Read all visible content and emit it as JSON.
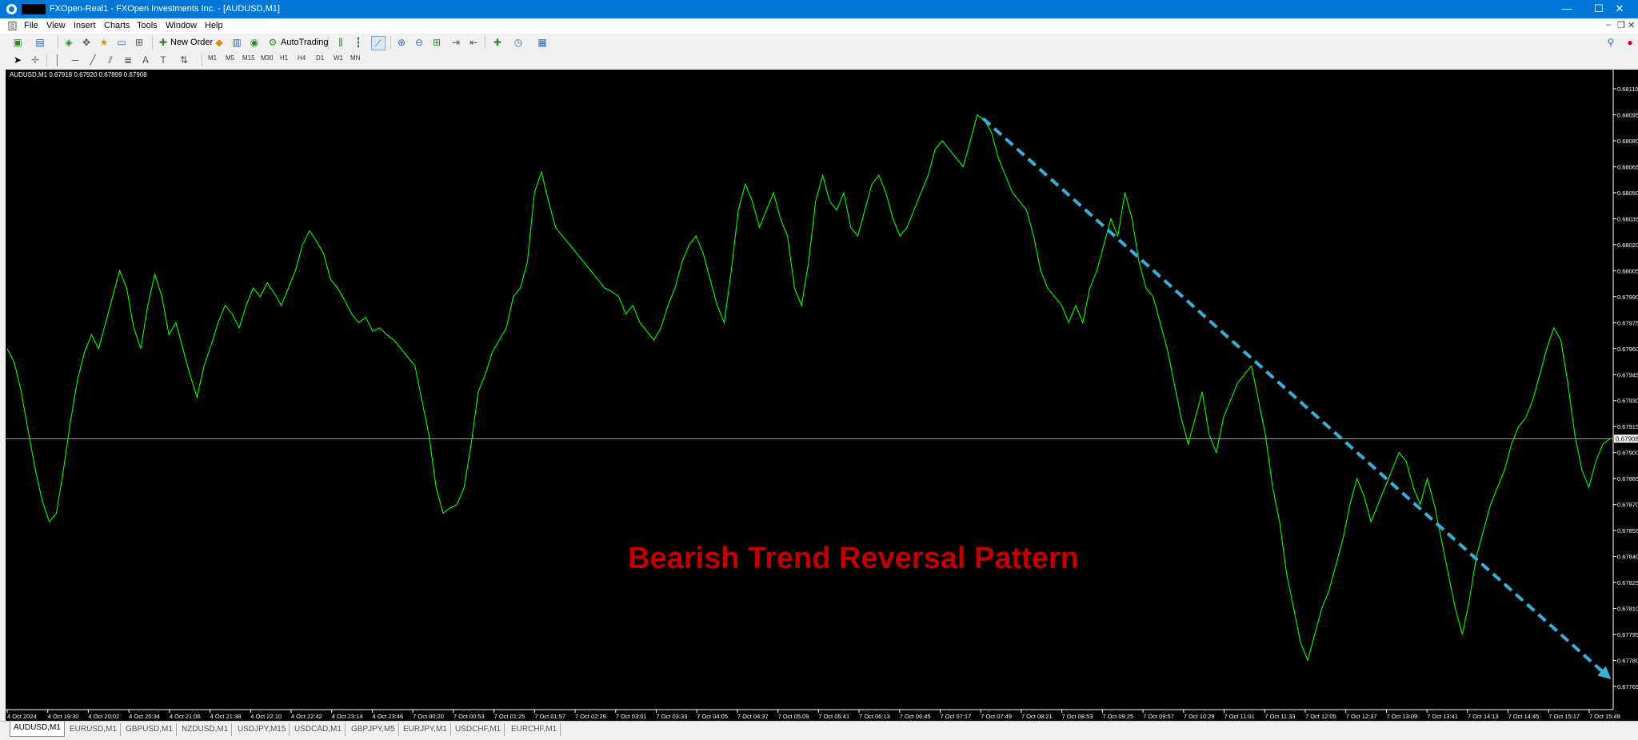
{
  "window": {
    "title": "FXOpen-Real1 - FXOpen Investments Inc. - [AUDUSD,M1]",
    "controls": [
      "—",
      "☐",
      "✕"
    ]
  },
  "menu": {
    "items": [
      "File",
      "View",
      "Insert",
      "Charts",
      "Tools",
      "Window",
      "Help"
    ]
  },
  "toolbar": {
    "new_order_label": "New Order",
    "autotrading_label": "AutoTrading"
  },
  "timeframes": [
    "M1",
    "M5",
    "M15",
    "M30",
    "H1",
    "H4",
    "D1",
    "W1",
    "MN"
  ],
  "chart": {
    "info": "AUDUSD,M1  0.67918 0.67920 0.67899 0.67908",
    "annotation": "Bearish Trend Reversal Pattern",
    "current_price_label": "0.67908",
    "colors": {
      "background": "#000000",
      "line": "#00ff00",
      "trend_arrow": "#3aaed8",
      "annotation": "#c00000"
    }
  },
  "chart_data": {
    "type": "line",
    "series": [
      {
        "y": [
          0.6796,
          0.67952,
          0.67935,
          0.67912,
          0.6789,
          0.67872,
          0.6786,
          0.67865,
          0.6789,
          0.67918,
          0.67942,
          0.67958,
          0.67968,
          0.6796,
          0.67975,
          0.6799,
          0.68005,
          0.67995,
          0.67972,
          0.6796,
          0.67985,
          0.68003,
          0.6799,
          0.67968,
          0.67975,
          0.6796,
          0.67945,
          0.67932,
          0.6795,
          0.67962,
          0.67975,
          0.67985,
          0.6798,
          0.67972,
          0.67985,
          0.67995,
          0.6799,
          0.67998,
          0.67992,
          0.67985,
          0.67995,
          0.68005,
          0.6802,
          0.68028,
          0.68022,
          0.68015,
          0.68,
          0.67995,
          0.67988,
          0.6798,
          0.67975,
          0.67978,
          0.6797,
          0.67972,
          0.67968,
          0.67965,
          0.6796,
          0.67955,
          0.6795,
          0.6793,
          0.6791,
          0.6788,
          0.67865,
          0.67868,
          0.6787,
          0.6788,
          0.67905,
          0.67935,
          0.67945,
          0.67958,
          0.67965,
          0.67972,
          0.6799,
          0.67995,
          0.6801,
          0.6805,
          0.68062,
          0.68045,
          0.6803,
          0.68025,
          0.6802,
          0.68015,
          0.6801,
          0.68005,
          0.68,
          0.67995,
          0.67993,
          0.6799,
          0.6798,
          0.67985,
          0.67975,
          0.6797,
          0.67965,
          0.67972,
          0.67985,
          0.67995,
          0.6801,
          0.6802,
          0.68025,
          0.68015,
          0.68,
          0.67985,
          0.67975,
          0.68005,
          0.6804,
          0.68055,
          0.68045,
          0.6803,
          0.6804,
          0.6805,
          0.68035,
          0.68025,
          0.67995,
          0.67985,
          0.6801,
          0.68045,
          0.6806,
          0.68045,
          0.6804,
          0.6805,
          0.6803,
          0.68025,
          0.6804,
          0.68055,
          0.6806,
          0.6805,
          0.68035,
          0.68025,
          0.6803,
          0.6804,
          0.6805,
          0.6806,
          0.68075,
          0.6808,
          0.68075,
          0.6807,
          0.68065,
          0.6808,
          0.68095,
          0.68092,
          0.68085,
          0.6807,
          0.6806,
          0.6805,
          0.68045,
          0.6804,
          0.68025,
          0.68005,
          0.67995,
          0.6799,
          0.67985,
          0.67975,
          0.67985,
          0.67975,
          0.67995,
          0.68005,
          0.6802,
          0.68035,
          0.68025,
          0.6805,
          0.68035,
          0.6801,
          0.67995,
          0.6799,
          0.67975,
          0.6796,
          0.6794,
          0.6792,
          0.67905,
          0.6792,
          0.67935,
          0.6791,
          0.679,
          0.6792,
          0.6793,
          0.6794,
          0.67945,
          0.6795,
          0.6793,
          0.6791,
          0.6788,
          0.6786,
          0.6783,
          0.6781,
          0.6779,
          0.6778,
          0.67795,
          0.6781,
          0.6782,
          0.67835,
          0.6785,
          0.6787,
          0.67885,
          0.67875,
          0.6786,
          0.6787,
          0.6788,
          0.6789,
          0.679,
          0.67895,
          0.6788,
          0.6787,
          0.67885,
          0.6787,
          0.6785,
          0.6783,
          0.6781,
          0.67795,
          0.67815,
          0.6784,
          0.67855,
          0.6787,
          0.6788,
          0.6789,
          0.67905,
          0.67915,
          0.6792,
          0.6793,
          0.67945,
          0.6796,
          0.67972,
          0.67965,
          0.6794,
          0.6791,
          0.6789,
          0.6788,
          0.67895,
          0.67905,
          0.67908
        ]
      }
    ],
    "x_ticks": [
      "4 Oct 2024",
      "4 Oct 19:30",
      "4 Oct 20:02",
      "4 Oct 20:34",
      "4 Oct 21:06",
      "4 Oct 21:38",
      "4 Oct 22:10",
      "4 Oct 22:42",
      "4 Oct 23:14",
      "4 Oct 23:46",
      "7 Oct 00:20",
      "7 Oct 00:53",
      "7 Oct 01:25",
      "7 Oct 01:57",
      "7 Oct 02:29",
      "7 Oct 03:01",
      "7 Oct 03:33",
      "7 Oct 04:05",
      "7 Oct 04:37",
      "7 Oct 05:09",
      "7 Oct 05:41",
      "7 Oct 06:13",
      "7 Oct 06:45",
      "7 Oct 07:17",
      "7 Oct 07:49",
      "7 Oct 08:21",
      "7 Oct 08:53",
      "7 Oct 09:25",
      "7 Oct 09:57",
      "7 Oct 10:29",
      "7 Oct 11:01",
      "7 Oct 11:33",
      "7 Oct 12:05",
      "7 Oct 12:37",
      "7 Oct 13:09",
      "7 Oct 13:41",
      "7 Oct 14:13",
      "7 Oct 14:45",
      "7 Oct 15:17",
      "7 Oct 15:49"
    ],
    "y_ticks": [
      "0.68110",
      "0.68095",
      "0.68080",
      "0.68065",
      "0.68050",
      "0.68035",
      "0.68020",
      "0.68005",
      "0.67990",
      "0.67975",
      "0.67960",
      "0.67945",
      "0.67930",
      "0.67915",
      "0.67900",
      "0.67885",
      "0.67870",
      "0.67855",
      "0.67840",
      "0.67825",
      "0.67810",
      "0.67795",
      "0.67780",
      "0.67765"
    ],
    "ylim": [
      0.67765,
      0.6811
    ],
    "grid": false
  },
  "tabs": [
    "AUDUSD,M1",
    "EURUSD,M1",
    "GBPUSD,M1",
    "NZDUSD,M1",
    "USDJPY,M15",
    "USDCAD,M1",
    "GBPJPY,M5",
    "EURJPY,M1",
    "USDCHF,M1",
    "EURCHF,M1"
  ]
}
